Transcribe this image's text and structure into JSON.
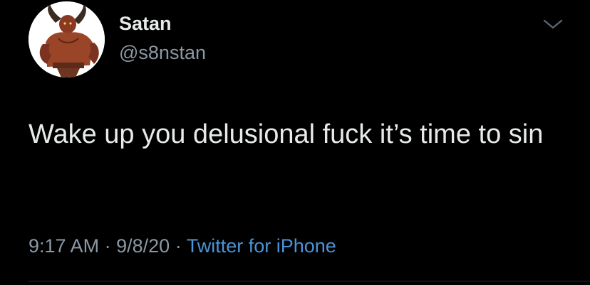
{
  "author": {
    "display_name": "Satan",
    "handle": "@s8nstan",
    "avatar_icon": "horned-demon-avatar"
  },
  "tweet": {
    "text": "Wake up you delusional fuck it’s time to sin",
    "time": "9:17 AM",
    "separator": "·",
    "date": "9/8/20",
    "source": "Twitter for iPhone"
  },
  "icons": {
    "menu": "chevron-down-icon"
  },
  "colors": {
    "background": "#000000",
    "primary_text": "#e7e9ea",
    "secondary_text": "#8b98a5",
    "link": "#4a93d6"
  }
}
